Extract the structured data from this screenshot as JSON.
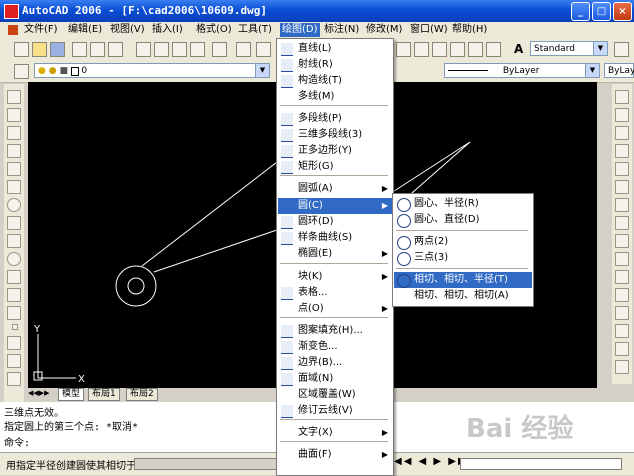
{
  "window": {
    "title": "AutoCAD 2006 - [F:\\cad2006\\10609.dwg]"
  },
  "menubar": {
    "items": [
      {
        "label": "文件(F)"
      },
      {
        "label": "编辑(E)"
      },
      {
        "label": "视图(V)"
      },
      {
        "label": "插入(I)"
      },
      {
        "label": "格式(O)"
      },
      {
        "label": "工具(T)"
      },
      {
        "label": "绘图(D)"
      },
      {
        "label": "标注(N)"
      },
      {
        "label": "修改(M)"
      },
      {
        "label": "窗口(W)"
      },
      {
        "label": "帮助(H)"
      }
    ]
  },
  "toolbar": {
    "text_style": "Standard",
    "layer_value": "0",
    "linetype": "ByLayer",
    "lineweight": "ByLayer"
  },
  "draw_menu": {
    "items": [
      {
        "label": "直线(L)",
        "icon": "line-icon"
      },
      {
        "label": "射线(R)",
        "icon": "ray-icon"
      },
      {
        "label": "构造线(T)",
        "icon": "xline-icon"
      },
      {
        "label": "多线(M)",
        "icon": ""
      },
      {
        "label": "多段线(P)",
        "icon": "polyline-icon"
      },
      {
        "label": "三维多段线(3)",
        "icon": "3dpoly-icon"
      },
      {
        "label": "正多边形(Y)",
        "icon": "polygon-icon"
      },
      {
        "label": "矩形(G)",
        "icon": "rectangle-icon"
      },
      {
        "label": "圆弧(A)",
        "icon": ""
      },
      {
        "label": "圆(C)",
        "icon": ""
      },
      {
        "label": "圆环(D)",
        "icon": "donut-icon"
      },
      {
        "label": "样条曲线(S)",
        "icon": "spline-icon"
      },
      {
        "label": "椭圆(E)",
        "icon": ""
      },
      {
        "label": "块(K)",
        "icon": ""
      },
      {
        "label": "表格...",
        "icon": "table-icon"
      },
      {
        "label": "点(O)",
        "icon": ""
      },
      {
        "label": "图案填充(H)...",
        "icon": "hatch-icon"
      },
      {
        "label": "渐变色...",
        "icon": "gradient-icon"
      },
      {
        "label": "边界(B)...",
        "icon": "boundary-icon"
      },
      {
        "label": "面域(N)",
        "icon": "region-icon"
      },
      {
        "label": "区域覆盖(W)",
        "icon": ""
      },
      {
        "label": "修订云线(V)",
        "icon": "revcloud-icon"
      },
      {
        "label": "文字(X)",
        "icon": ""
      },
      {
        "label": "曲面(F)",
        "icon": ""
      }
    ]
  },
  "circle_submenu": {
    "items": [
      {
        "label": "圆心、半径(R)"
      },
      {
        "label": "圆心、直径(D)"
      },
      {
        "label": "两点(2)"
      },
      {
        "label": "三点(3)"
      },
      {
        "label": "相切、相切、半径(T)"
      },
      {
        "label": "相切、相切、相切(A)"
      }
    ]
  },
  "layout_tabs": [
    "模型",
    "布局1",
    "布局2"
  ],
  "command_lines": [
    "三维点无效。",
    "指定圆上的第三个点: *取消*",
    "命令:"
  ],
  "status_text": "用指定半径创建圆使其相切于",
  "axis": {
    "y": "Y",
    "x": "X"
  },
  "watermark": "Bai 经验",
  "colors": {
    "highlight": "#316ac5",
    "canvas": "#000000",
    "titlebar": "#0a4fd4"
  }
}
